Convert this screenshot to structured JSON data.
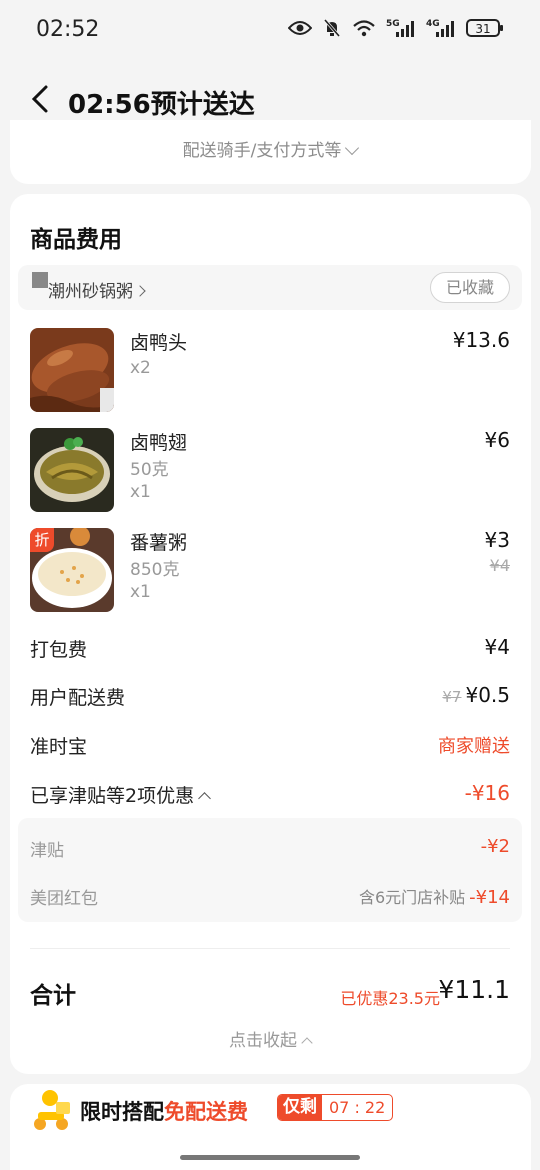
{
  "status_bar": {
    "time": "02:52",
    "battery": "31",
    "signal_1": "5G",
    "signal_2": "4G"
  },
  "nav": {
    "title": "02:56预计送达"
  },
  "more_info": {
    "label": "配送骑手/支付方式等"
  },
  "fees_section": {
    "title": "商品费用"
  },
  "shop": {
    "name": "潮州砂锅粥",
    "favorite_label": "已收藏"
  },
  "items": [
    {
      "name": "卤鸭头",
      "spec": "",
      "qty": "x2",
      "price": "¥13.6",
      "orig_price": ""
    },
    {
      "name": "卤鸭翅",
      "spec": "50克",
      "qty": "x1",
      "price": "¥6",
      "orig_price": ""
    },
    {
      "name": "番薯粥",
      "spec": "850克",
      "qty": "x1",
      "price": "¥3",
      "orig_price": "¥4",
      "tag": "折"
    }
  ],
  "fees": {
    "packing": {
      "label": "打包费",
      "value": "¥4"
    },
    "delivery": {
      "label": "用户配送费",
      "orig": "¥7",
      "value": "¥0.5"
    },
    "ontime": {
      "label": "准时宝",
      "value": "商家赠送"
    },
    "discount_summary": {
      "label": "已享津贴等2项优惠",
      "value": "-¥16"
    }
  },
  "discounts": [
    {
      "label": "津贴",
      "note": "",
      "value": "-¥2"
    },
    {
      "label": "美团红包",
      "note": "含6元门店补贴",
      "value": "-¥14"
    }
  ],
  "total": {
    "label": "合计",
    "saved": "已优惠23.5元",
    "value": "¥11.1"
  },
  "collapse": {
    "label": "点击收起"
  },
  "promo": {
    "text_1": "限时搭配",
    "text_2": "免配送费",
    "tag": "仅剩",
    "time": "07 : 22"
  },
  "colors": {
    "accent": "#ee4b2b",
    "background": "#f4f4f4",
    "card": "#ffffff"
  }
}
